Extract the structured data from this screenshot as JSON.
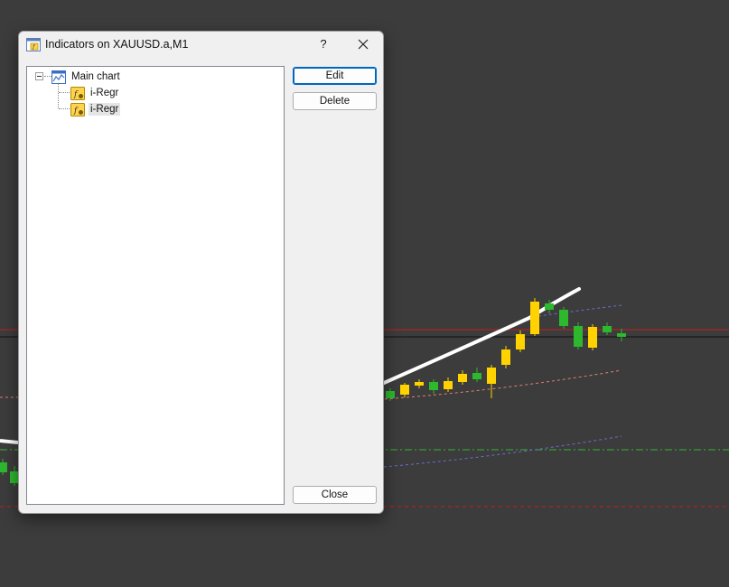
{
  "dialog": {
    "title": "Indicators on XAUUSD.a,M1",
    "help_label": "?"
  },
  "tree": {
    "root": {
      "label": "Main chart",
      "icon": "chart-window-icon"
    },
    "children": [
      {
        "label": "i-Regr",
        "icon": "custom-indicator-icon",
        "selected": false
      },
      {
        "label": "i-Regr",
        "icon": "custom-indicator-icon",
        "selected": true
      }
    ]
  },
  "buttons": {
    "edit": "Edit",
    "delete": "Delete",
    "close": "Close"
  },
  "colors": {
    "chart_background": "#3c3c3c",
    "bull_candle": "#2eb82e",
    "bear_candle": "#ffd200",
    "regression_line": "#ffffff",
    "upper_channel": "#6b6bd6",
    "lower_channel": "#e08070",
    "support_line": "#35b535",
    "price_line": "#c41e1e",
    "accent": "#0067c0"
  }
}
